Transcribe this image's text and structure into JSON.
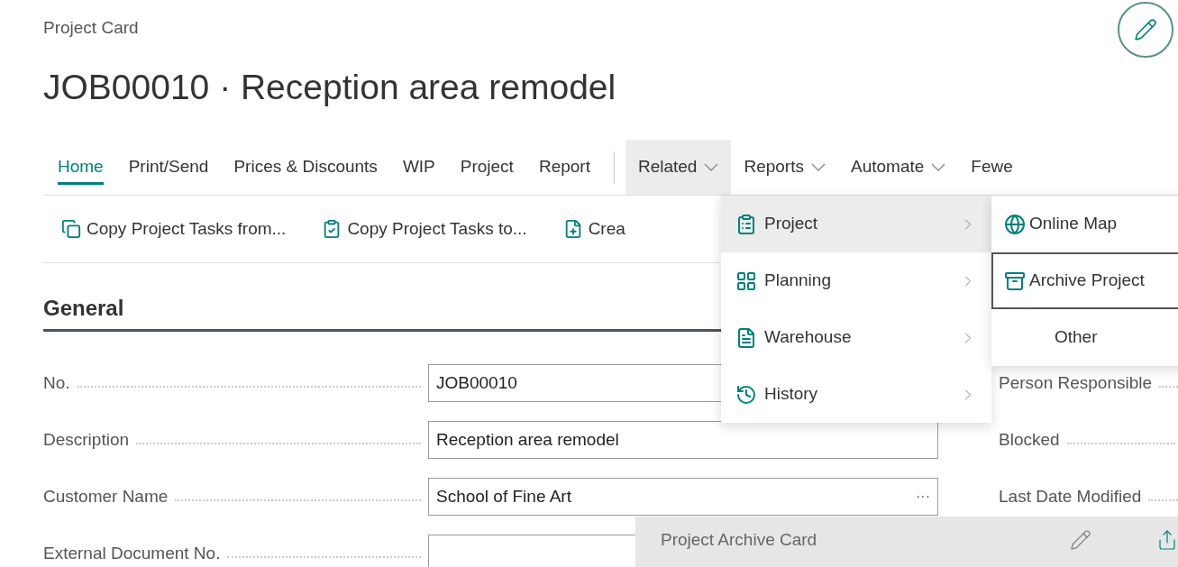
{
  "breadcrumb": "Project Card",
  "title": "JOB00010 · Reception area remodel",
  "action_tabs": [
    {
      "label": "Home",
      "selected": true,
      "kind": "tab"
    },
    {
      "label": "Print/Send",
      "selected": false,
      "kind": "tab"
    },
    {
      "label": "Prices & Discounts",
      "selected": false,
      "kind": "tab"
    },
    {
      "label": "WIP",
      "selected": false,
      "kind": "tab"
    },
    {
      "label": "Project",
      "selected": false,
      "kind": "tab"
    },
    {
      "label": "Report",
      "selected": false,
      "kind": "tab"
    },
    {
      "label": "Related",
      "selected": true,
      "kind": "menu"
    },
    {
      "label": "Reports",
      "selected": false,
      "kind": "menu"
    },
    {
      "label": "Automate",
      "selected": false,
      "kind": "menu"
    },
    {
      "label": "Fewe",
      "selected": false,
      "kind": "cut"
    }
  ],
  "actions": [
    {
      "label": "Copy Project Tasks from..."
    },
    {
      "label": "Copy Project Tasks to..."
    },
    {
      "label": "Crea"
    }
  ],
  "section": "General",
  "fields": [
    {
      "label": "No.",
      "value": "JOB00010"
    },
    {
      "label": "Description",
      "value": "Reception area remodel"
    },
    {
      "label": "Customer Name",
      "value": "School of Fine Art",
      "button": "···"
    },
    {
      "label": "External Document No."
    }
  ],
  "right_fields": [
    {
      "label": "Person Responsible"
    },
    {
      "label": "Blocked"
    },
    {
      "label": "Last Date Modified"
    }
  ],
  "menu": [
    {
      "label": "Project",
      "selected": true
    },
    {
      "label": "Planning",
      "selected": false
    },
    {
      "label": "Warehouse",
      "selected": false
    },
    {
      "label": "History",
      "selected": false
    }
  ],
  "submenu": [
    {
      "label": "Online Map",
      "focused": false,
      "kind": "icon"
    },
    {
      "label": "Archive Project",
      "focused": true,
      "kind": "icon"
    },
    {
      "label": "Other",
      "focused": false,
      "kind": "plain"
    }
  ],
  "overlay": {
    "title": "Project Archive Card"
  }
}
